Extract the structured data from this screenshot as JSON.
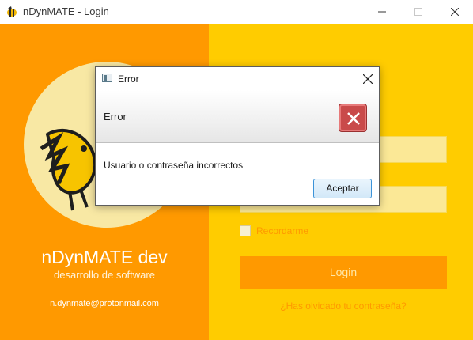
{
  "window": {
    "title": "nDynMATE - Login",
    "app_icon": "bee-icon",
    "controls": [
      "minimize-icon",
      "maximize-icon",
      "close-icon"
    ]
  },
  "brand": {
    "name": "nDynMATE dev",
    "tagline": "desarrollo de software",
    "email": "n.dynmate@protonmail.com",
    "colors": {
      "left_panel": "#ff9900",
      "right_panel": "#ffcc00",
      "moon": "#f8e8a4"
    }
  },
  "login_form": {
    "remember_label": "Recordarme",
    "remember_checked": false,
    "login_button": "Login",
    "forgot_link": "¿Has olvidado tu contraseña?"
  },
  "error_dialog": {
    "title": "Error",
    "header": "Error",
    "message": "Usuario o contraseña incorrectos",
    "ok_button": "Aceptar",
    "icon": "error-x-icon"
  }
}
